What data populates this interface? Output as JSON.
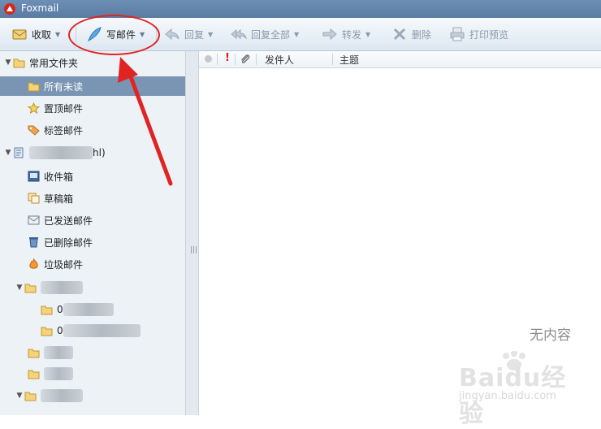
{
  "window": {
    "title": "Foxmail"
  },
  "toolbar": {
    "receive": "收取",
    "compose": "写邮件",
    "reply": "回复",
    "reply_all": "回复全部",
    "forward": "转发",
    "delete": "删除",
    "print_preview": "打印预览"
  },
  "sidebar": {
    "common_group": "常用文件夹",
    "common_items": [
      "所有未读",
      "置顶邮件",
      "标签邮件"
    ],
    "account_suffix": "hl)",
    "account_items": [
      "收件箱",
      "草稿箱",
      "已发送邮件",
      "已删除邮件",
      "垃圾邮件"
    ],
    "subfolder_prefixes": [
      "0",
      "0"
    ]
  },
  "list": {
    "header": {
      "from": "发件人",
      "subject": "主题"
    },
    "empty_text": "无内容"
  },
  "watermark": {
    "brand": "Baidu经验",
    "url": "jingyan.baidu.com"
  },
  "colors": {
    "annotation": "#e02424",
    "selected_row": "#7a95b3",
    "titlebar": "#5a7ca4"
  }
}
